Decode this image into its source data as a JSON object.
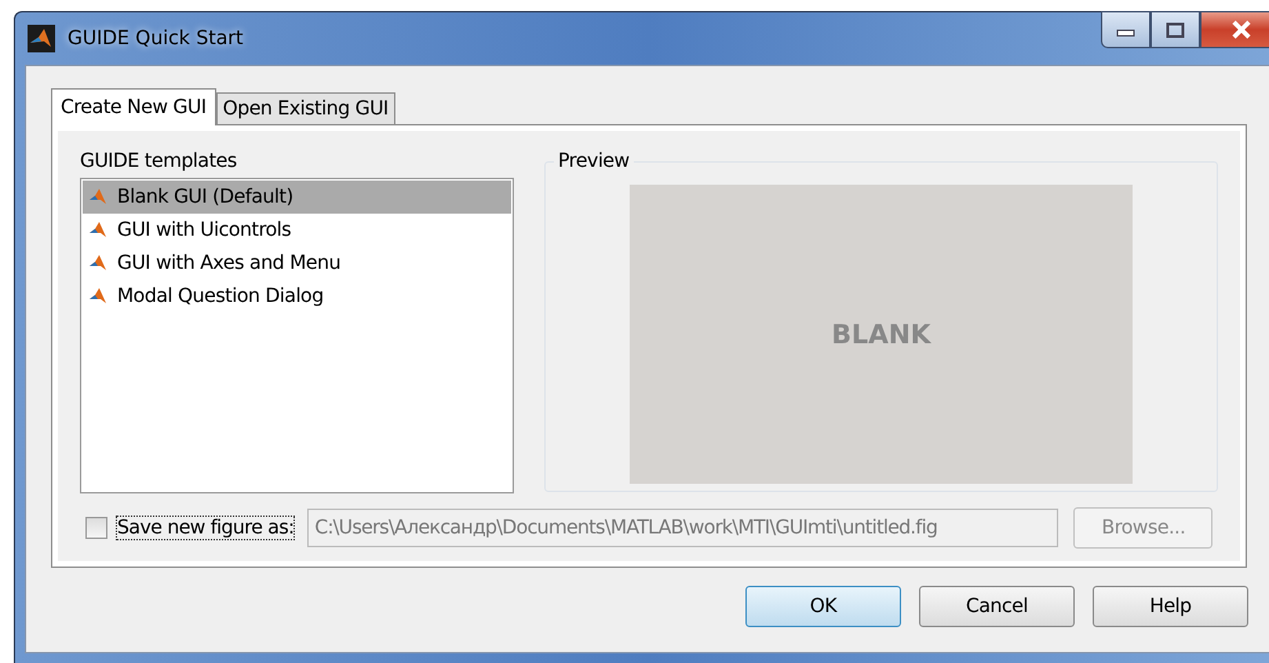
{
  "window": {
    "title": "GUIDE Quick Start"
  },
  "tabs": [
    {
      "label": "Create New GUI",
      "selected": true
    },
    {
      "label": "Open Existing GUI",
      "selected": false
    }
  ],
  "templates": {
    "label": "GUIDE templates",
    "items": [
      {
        "label": "Blank GUI (Default)",
        "selected": true
      },
      {
        "label": "GUI with Uicontrols",
        "selected": false
      },
      {
        "label": "GUI with Axes and Menu",
        "selected": false
      },
      {
        "label": "Modal Question Dialog",
        "selected": false
      }
    ]
  },
  "preview": {
    "label": "Preview",
    "text": "BLANK"
  },
  "save_figure": {
    "label": "Save new figure as:",
    "checked": false,
    "value": "C:\\Users\\Александр\\Documents\\MATLAB\\work\\MTI\\GUImti\\untitled.fig",
    "disabled": true
  },
  "browse": {
    "label": "Browse...",
    "disabled": true
  },
  "buttons": [
    {
      "label": "OK",
      "default": true
    },
    {
      "label": "Cancel",
      "default": false
    },
    {
      "label": "Help",
      "default": false
    }
  ]
}
